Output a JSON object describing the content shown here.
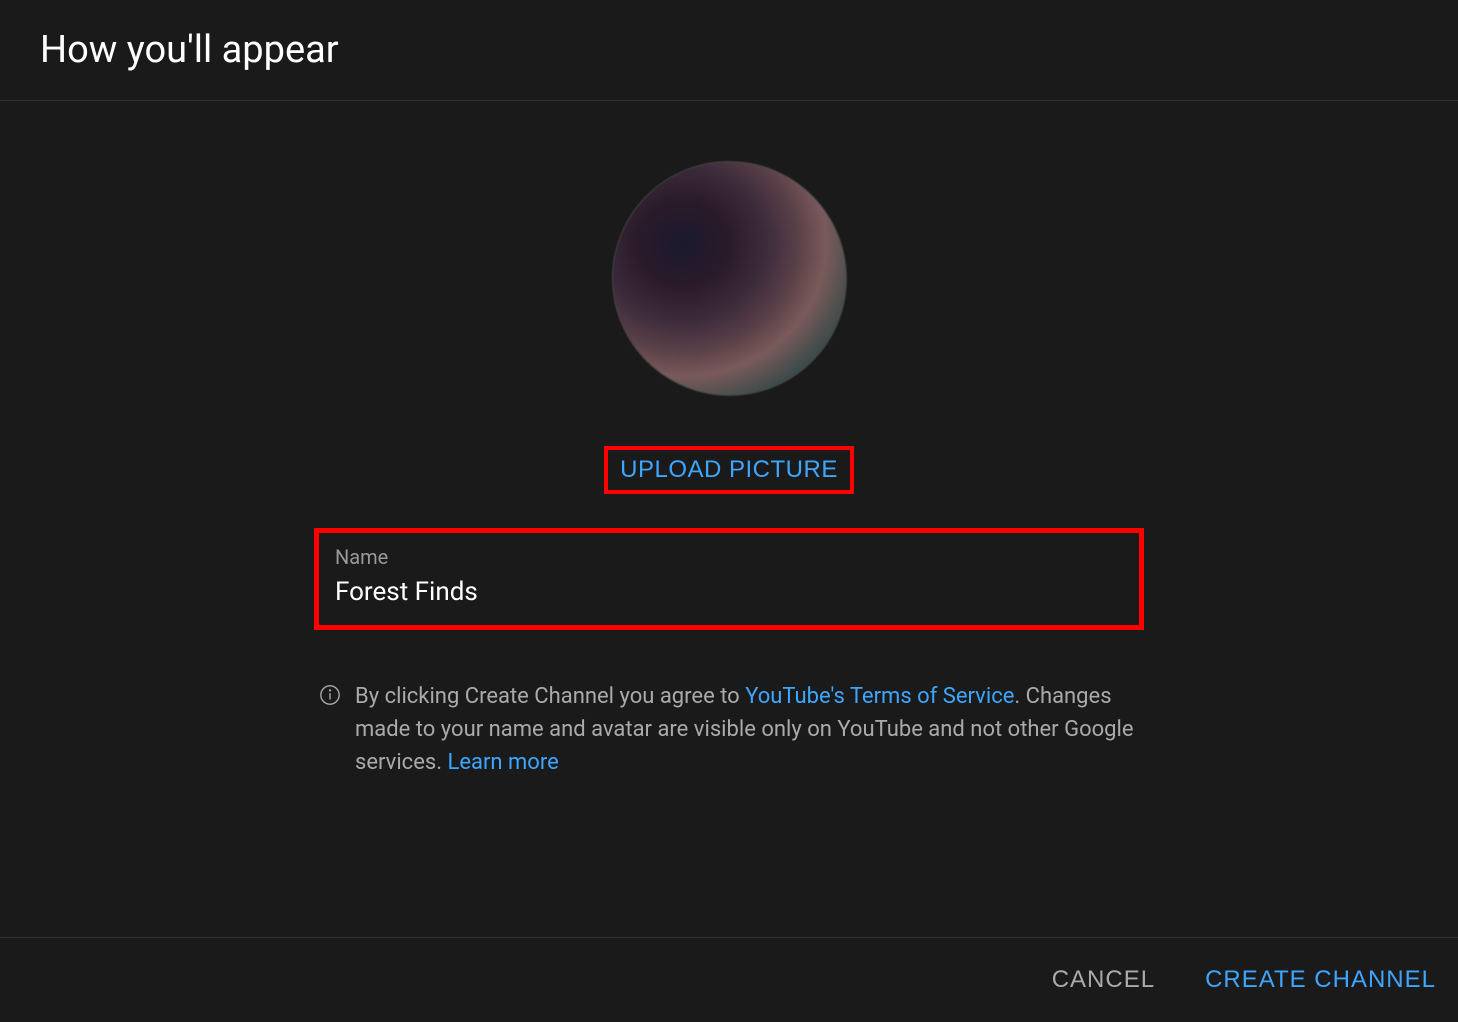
{
  "header": {
    "title": "How you'll appear"
  },
  "upload": {
    "button_label": "UPLOAD PICTURE"
  },
  "name_field": {
    "label": "Name",
    "value": "Forest Finds"
  },
  "terms": {
    "text_before": "By clicking Create Channel you agree to ",
    "tos_link": "YouTube's Terms of Service",
    "text_middle": ". Changes made to your name and avatar are visible only on YouTube and not other Google services. ",
    "learn_more": "Learn more"
  },
  "footer": {
    "cancel_label": "CANCEL",
    "create_label": "CREATE CHANNEL"
  }
}
